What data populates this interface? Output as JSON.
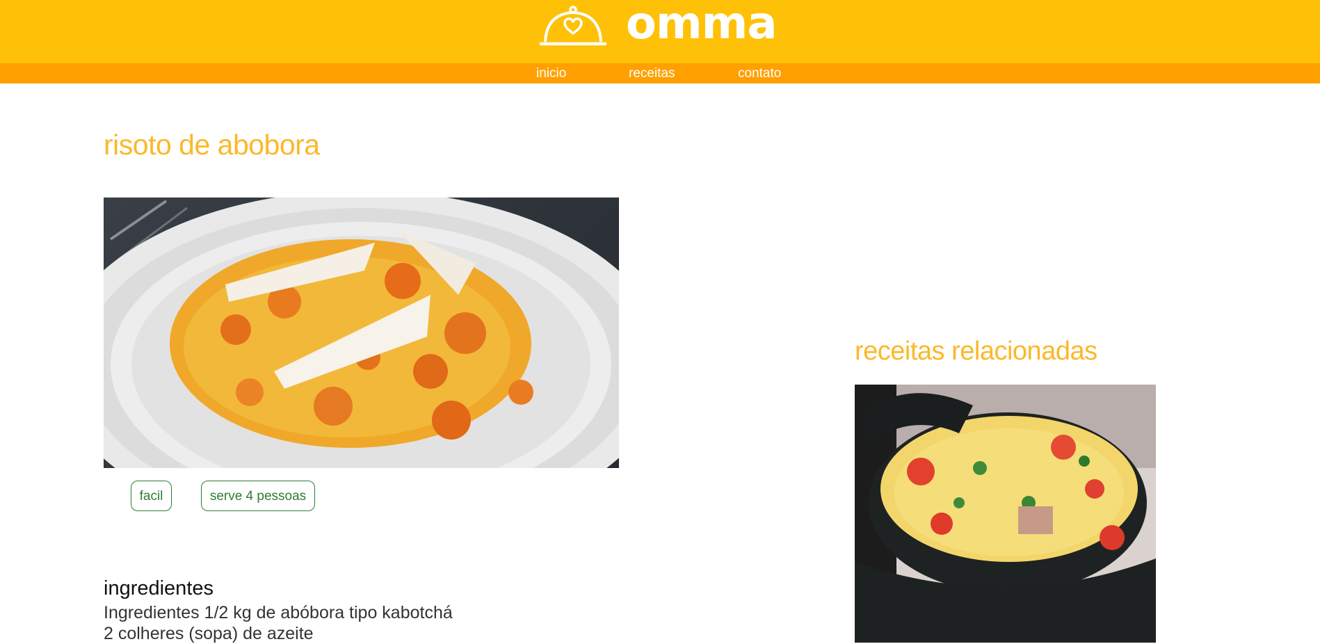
{
  "brand": {
    "name": "omma",
    "icon": "cloche-heart-icon"
  },
  "nav": {
    "items": [
      {
        "label": "inicio"
      },
      {
        "label": "receitas"
      },
      {
        "label": "contato"
      }
    ]
  },
  "recipe": {
    "title": "risoto de abobora",
    "tags": {
      "difficulty": "facil",
      "serves": "serve 4 pessoas"
    },
    "ingredients_heading": "ingredientes",
    "ingredients": [
      "Ingredientes 1/2 kg de abóbora tipo kabotchá",
      "2 colheres (sopa) de azeite"
    ]
  },
  "related": {
    "title": "receitas relacionadas"
  },
  "colors": {
    "header": "#FFC107",
    "navbar": "#FFA000",
    "title": "#FBB829",
    "tag": "#2E7D32"
  }
}
